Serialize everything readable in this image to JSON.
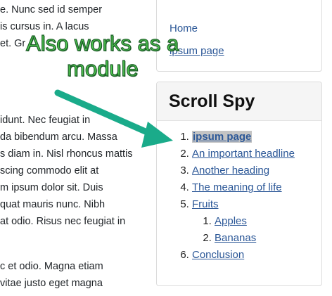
{
  "article": {
    "lines_top": [
      "e. Nunc sed id semper",
      "is cursus in. A lacus",
      "et. Gr"
    ],
    "lines_mid": [
      "idunt. Nec feugiat in",
      "da bibendum arcu. Massa",
      "s diam in. Nisl rhoncus mattis",
      "scing commodo elit at",
      "m ipsum dolor sit. Duis",
      "quat mauris nunc. Nibh",
      "at odio. Risus nec feugiat in"
    ],
    "lines_bottom": [
      "c et odio. Magna etiam",
      "vitae justo eget magna"
    ]
  },
  "top_module": {
    "links": [
      "Home",
      "ipsum page"
    ]
  },
  "scroll_spy": {
    "title": "Scroll Spy",
    "items": [
      {
        "label": "ipsum page",
        "active": true
      },
      {
        "label": "An important headline"
      },
      {
        "label": "Another heading"
      },
      {
        "label": "The meaning of life"
      },
      {
        "label": "Fruits",
        "children": [
          "Apples",
          "Bananas"
        ]
      },
      {
        "label": "Conclusion"
      }
    ]
  },
  "callout": {
    "line1": "Also works as a",
    "line2": "module",
    "color": "#4fc94f",
    "arrow_color": "#1aab8a"
  }
}
